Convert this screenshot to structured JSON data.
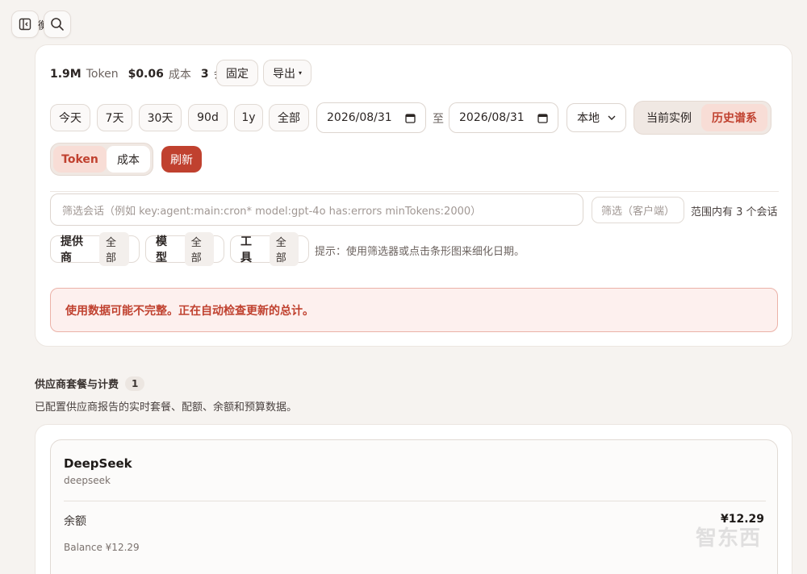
{
  "topbar": {
    "hidden_title_glyph": "衡"
  },
  "summary": {
    "tokens_value": "1.9M",
    "tokens_label": "Token",
    "cost_value": "$0.06",
    "cost_label": "成本",
    "sessions_value": "3",
    "sessions_label": "会话",
    "pin_label": "固定",
    "export_label": "导出"
  },
  "ranges": [
    "今天",
    "7天",
    "30天",
    "90d",
    "1y",
    "全部"
  ],
  "dates": {
    "start": "2026/08/31",
    "to": "至",
    "end": "2026/08/31"
  },
  "timezone": {
    "selected": "本地"
  },
  "source_toggle": {
    "current": "当前实例",
    "history": "历史谱系"
  },
  "metric_toggle": {
    "token": "Token",
    "cost": "成本"
  },
  "refresh_label": "刷新",
  "filter": {
    "placeholder": "筛选会话（例如 key:agent:main:cron* model:gpt-4o has:errors minTokens:2000）",
    "client_placeholder": "筛选（客户端）",
    "range_count": "范围内有 3 个会话"
  },
  "chips": [
    {
      "label": "提供商",
      "value": "全部"
    },
    {
      "label": "模型",
      "value": "全部"
    },
    {
      "label": "工具",
      "value": "全部"
    }
  ],
  "hint": "提示：使用筛选器或点击条形图来细化日期。",
  "warning": "使用数据可能不完整。正在自动检查更新的总计。",
  "plans": {
    "title": "供应商套餐与计费",
    "count": "1",
    "subtitle": "已配置供应商报告的实时套餐、配额、余额和预算数据。",
    "provider": {
      "name": "DeepSeek",
      "id": "deepseek",
      "balance_label": "余额",
      "balance_value": "¥12.29",
      "balance_detail": "Balance ¥12.29"
    }
  },
  "colors": {
    "accent": "#c0412f",
    "warning_bg": "#fdf0ee",
    "warning_border": "#ebb2a8"
  },
  "watermark": "智东西"
}
